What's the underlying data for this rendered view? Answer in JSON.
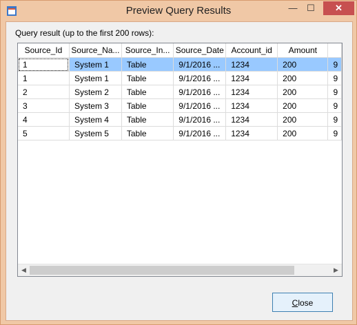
{
  "window": {
    "title": "Preview Query Results",
    "min_glyph": "—",
    "max_glyph": "☐",
    "close_glyph": "✕"
  },
  "grid": {
    "label": "Query result (up to the first 200 rows):",
    "columns": [
      "Source_Id",
      "Source_Na...",
      "Source_In...",
      "Source_Date",
      "Account_id",
      "Amount",
      ""
    ],
    "rows": [
      [
        "1",
        "System 1",
        "Table",
        "9/1/2016 ...",
        "1234",
        "200",
        "9"
      ],
      [
        "1",
        "System 1",
        "Table",
        "9/1/2016 ...",
        "1234",
        "200",
        "9"
      ],
      [
        "2",
        "System 2",
        "Table",
        "9/1/2016 ...",
        "1234",
        "200",
        "9"
      ],
      [
        "3",
        "System 3",
        "Table",
        "9/1/2016 ...",
        "1234",
        "200",
        "9"
      ],
      [
        "4",
        "System 4",
        "Table",
        "9/1/2016 ...",
        "1234",
        "200",
        "9"
      ],
      [
        "5",
        "System 5",
        "Table",
        "9/1/2016 ...",
        "1234",
        "200",
        "9"
      ]
    ],
    "selected_row": 0,
    "scroll_left_glyph": "◀",
    "scroll_right_glyph": "▶"
  },
  "buttons": {
    "close_accel": "C",
    "close_rest": "lose"
  },
  "colors": {
    "selection": "#99c9ff",
    "title_bar": "#f0c8a6",
    "close_button": "#c75050"
  }
}
